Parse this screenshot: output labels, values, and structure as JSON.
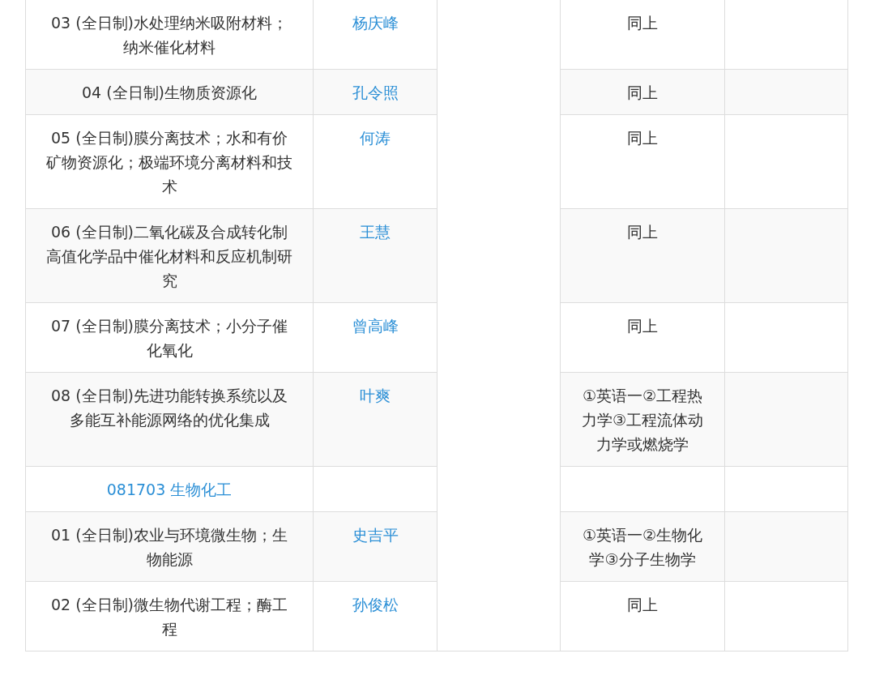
{
  "table": {
    "rows": [
      {
        "kind": "direction",
        "direction": "03 (全日制)水处理纳米吸附材料；纳米催化材料",
        "supervisor": "杨庆峰",
        "exam": "同上"
      },
      {
        "kind": "direction",
        "direction": "04 (全日制)生物质资源化",
        "supervisor": "孔令照",
        "exam": "同上"
      },
      {
        "kind": "direction",
        "direction": "05 (全日制)膜分离技术；水和有价矿物资源化；极端环境分离材料和技术",
        "supervisor": "何涛",
        "exam": "同上"
      },
      {
        "kind": "direction",
        "direction": "06 (全日制)二氧化碳及合成转化制高值化学品中催化材料和反应机制研究",
        "supervisor": "王慧",
        "exam": "同上"
      },
      {
        "kind": "direction",
        "direction": "07 (全日制)膜分离技术；小分子催化氧化",
        "supervisor": "曾高峰",
        "exam": "同上"
      },
      {
        "kind": "direction",
        "direction": "08 (全日制)先进功能转换系统以及多能互补能源网络的优化集成",
        "supervisor": "叶爽",
        "exam": "①英语一②工程热力学③工程流体动力学或燃烧学"
      },
      {
        "kind": "major",
        "direction": "081703 生物化工"
      },
      {
        "kind": "direction",
        "direction": "01 (全日制)农业与环境微生物；生物能源",
        "supervisor": "史吉平",
        "exam": "①英语一②生物化学③分子生物学"
      },
      {
        "kind": "direction",
        "direction": "02 (全日制)微生物代谢工程；酶工程",
        "supervisor": "孙俊松",
        "exam": "同上"
      }
    ]
  }
}
